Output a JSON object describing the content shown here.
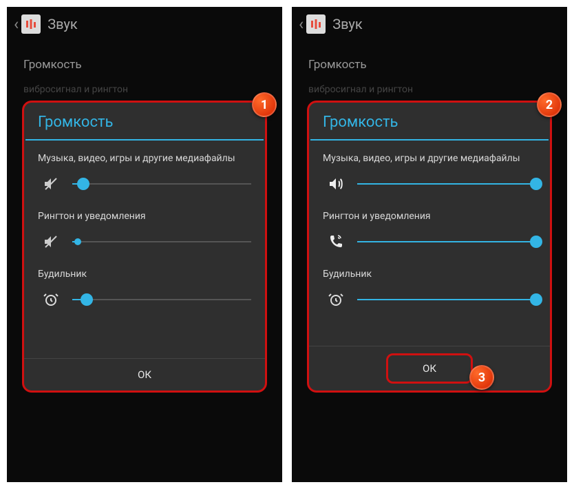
{
  "header": {
    "title": "Звук"
  },
  "section_label": "Громкость",
  "dimmed_text": "вибросигнал и рингтон",
  "dialog": {
    "title": "Громкость",
    "ok": "ОК",
    "sliders": {
      "media": {
        "label": "Музыка, видео, игры и другие медиафайлы"
      },
      "ring": {
        "label": "Рингтон и уведомления"
      },
      "alarm": {
        "label": "Будильник"
      }
    }
  },
  "panels": [
    {
      "badge": "1",
      "media_pct": 6,
      "media_muted": true,
      "ring_pct": 3,
      "ring_muted": true,
      "ring_small": true,
      "alarm_pct": 8
    },
    {
      "badge": "2",
      "media_pct": 100,
      "media_muted": false,
      "ring_pct": 100,
      "ring_muted": false,
      "ring_small": false,
      "alarm_pct": 100
    }
  ],
  "badge3": "3"
}
